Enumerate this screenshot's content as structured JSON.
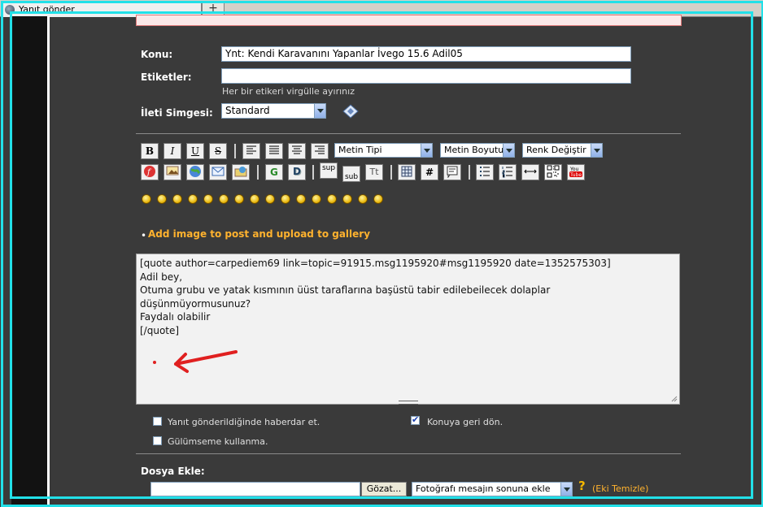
{
  "tab": {
    "title": "Yanıt gönder",
    "new_tab": "+"
  },
  "form": {
    "konu_label": "Konu:",
    "konu_value": "Ynt: Kendi Karavanını Yapanlar İvego 15.6  Adil05",
    "etiketler_label": "Etiketler:",
    "etiketler_value": "",
    "etiketler_hint": "Her bir etikeri virgülle ayırınız",
    "ileti_label": "İleti Simgesi:",
    "ileti_value": "Standard"
  },
  "toolbar": {
    "bold": "B",
    "italic": "I",
    "underline": "U",
    "strike": "S",
    "font_type": "Metin Tipi",
    "font_size": "Metin Boyutu",
    "color": "Renk Değiştir",
    "sup": "sup",
    "sub": "sub",
    "tt": "Tt",
    "hash": "#"
  },
  "gallery_link": "Add image to post and upload to gallery",
  "editor_lines": [
    "[quote author=carpediem69 link=topic=91915.msg1195920#msg1195920 date=1352575303]",
    "Adil bey,",
    "Otuma grubu ve yatak kısmının üüst taraflarına başüstü tabir edilebeilecek dolaplar",
    "düşünmüyormusunuz?",
    "Faydalı olabilir",
    "[/quote]"
  ],
  "options": {
    "notify_label": "Yanıt gönderildiğinde haberdar et.",
    "notify_checked": false,
    "return_label": "Konuya geri dön.",
    "return_checked": true,
    "no_smiley_label": "Gülümseme kullanma.",
    "no_smiley_checked": false
  },
  "attach": {
    "label": "Dosya Ekle:",
    "browse": "Gözat...",
    "placement": "Fotoğrafı mesajın sonuna ekle",
    "help": "?",
    "clear": "(Eki Temizle)"
  },
  "colors": {
    "frame": "#22e0e8",
    "accent": "#ffb22e",
    "annotation": "#e02020"
  }
}
